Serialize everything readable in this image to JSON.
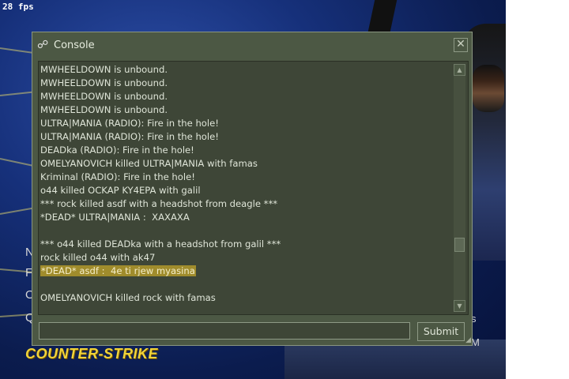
{
  "hud": {
    "fps": "28 fps"
  },
  "background": {
    "menu_peek_left": [
      "N",
      "F",
      "O",
      "Q"
    ],
    "menu_peek_right": [
      "s",
      "M"
    ],
    "logo_text": "COUNTER-STRIKE"
  },
  "console": {
    "title": "Console",
    "close_glyph": "✕",
    "icon_glyph": "☍",
    "lines": [
      "MWHEELDOWN is unbound.",
      "MWHEELDOWN is unbound.",
      "MWHEELDOWN is unbound.",
      "MWHEELDOWN is unbound.",
      "ULTRA|MANIA (RADIO): Fire in the hole!",
      "ULTRA|MANIA (RADIO): Fire in the hole!",
      "DEADka (RADIO): Fire in the hole!",
      "OMELYANOVICH killed ULTRA|MANIA with famas",
      "Kriminal (RADIO): Fire in the hole!",
      "o44 killed OCKAP KY4EPA with galil",
      "*** rock killed asdf with a headshot from deagle ***",
      "*DEAD* ULTRA|MANIA :  XAXAXA",
      "",
      "*** o44 killed DEADka with a headshot from galil ***",
      "rock killed o44 with ak47",
      "*DEAD* asdf :  4e ti rjew myasina",
      "",
      "OMELYANOVICH killed rock with famas"
    ],
    "highlighted_line_index": 15,
    "input": {
      "value": "",
      "placeholder": ""
    },
    "submit_label": "Submit",
    "scroll_up_glyph": "▲",
    "scroll_down_glyph": "▼",
    "resize_glyph": "◢"
  }
}
